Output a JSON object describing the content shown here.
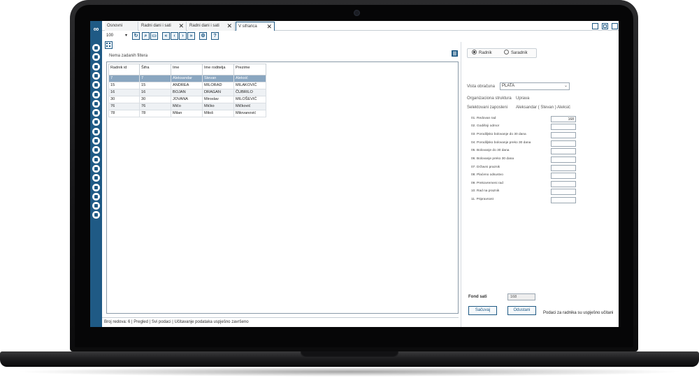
{
  "tabs": [
    {
      "label": "Osnovni",
      "closable": false
    },
    {
      "label": "Radni dani i sati",
      "closable": true
    },
    {
      "label": "Radni dani i sati",
      "closable": true
    },
    {
      "label": "V sifrarica",
      "closable": true
    }
  ],
  "toolbar": {
    "page_size": "100"
  },
  "grid": {
    "filter_text": "Nema zadanih filtera",
    "columns": [
      "Radnik id",
      "Šifra",
      "Ime",
      "Ime roditelja",
      "Prezime"
    ],
    "rows": [
      [
        "7",
        "7",
        "Aleksandar",
        "Stevan",
        "Aleksić"
      ],
      [
        "15",
        "15",
        "ANDREA",
        "MILORAD",
        "MILAKOVIĆ"
      ],
      [
        "16",
        "16",
        "BOJAN",
        "DRAGAN",
        "ČUBRILO"
      ],
      [
        "30",
        "30",
        "JOVANA",
        "Miroslav",
        "MILOŠEVIĆ"
      ],
      [
        "76",
        "76",
        "Mičo",
        "Mićko",
        "Mičković"
      ],
      [
        "78",
        "78",
        "Milan",
        "Miloš",
        "Milovanović"
      ]
    ]
  },
  "status": {
    "count_label": "Broj redova:",
    "count_value": "6",
    "mode": "Pregled",
    "scope": "Svi podaci",
    "message": "Učitavanje podataka uspješno završeno"
  },
  "right": {
    "radio_options": [
      "Radnik",
      "Saradnik"
    ],
    "vista_label": "Vista obračuna",
    "vista_value": "PLATA",
    "org_label": "Organizaciona struktura",
    "org_value": "Uprava",
    "emp_label": "Selektovani zaposleni",
    "emp_value": "Aleksandar ( Stevan ) Aleksić",
    "hours": [
      {
        "label": "01. Redovan rad",
        "value": "168"
      },
      {
        "label": "02. Godišnji odmor",
        "value": ""
      },
      {
        "label": "03. Porodiljsko bolovanje do 30 dana",
        "value": ""
      },
      {
        "label": "04. Porodiljsko bolovanje preko 30 dana",
        "value": ""
      },
      {
        "label": "05. Bolovanje do 30 dana",
        "value": ""
      },
      {
        "label": "06. Bolovanje preko 30 dana",
        "value": ""
      },
      {
        "label": "07. Državni praznik",
        "value": ""
      },
      {
        "label": "08. Plaćeno odsustvo",
        "value": ""
      },
      {
        "label": "09. Prekovremeni rad",
        "value": ""
      },
      {
        "label": "10. Rad na praznik",
        "value": ""
      },
      {
        "label": "11. Pripravnost",
        "value": ""
      }
    ],
    "fond_label": "Fond sati",
    "fond_value": "168",
    "save_label": "Sačuvaj",
    "cancel_label": "Odustani",
    "message": "Podaci za radnika su uspješno učitani"
  },
  "colors": {
    "sidebar": "#1f5a85",
    "selected_row": "#8aa6c0"
  }
}
